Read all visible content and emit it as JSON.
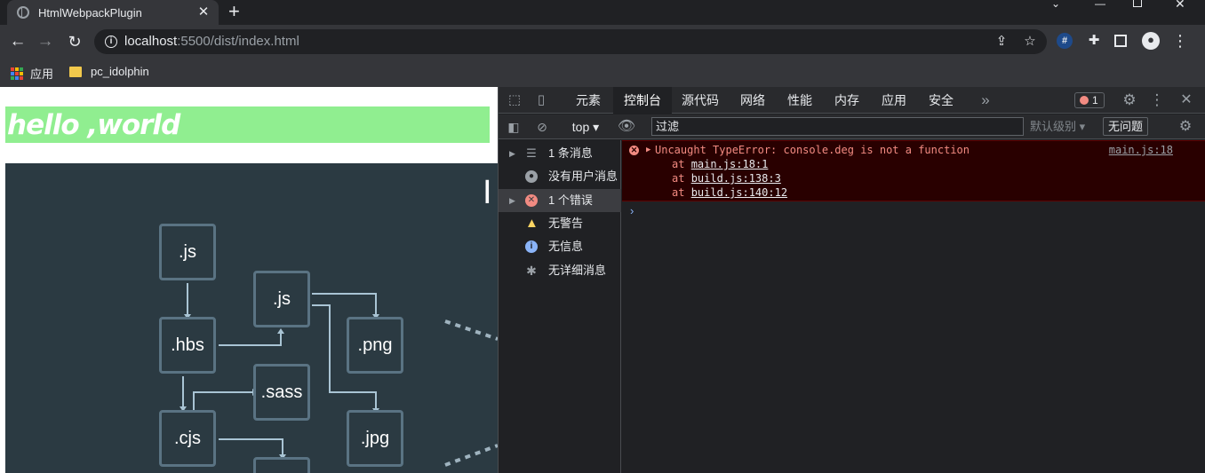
{
  "browser": {
    "tab_title": "HtmlWebpackPlugin",
    "url_host": "localhost",
    "url_rest": ":5500/dist/index.html",
    "bookmarks": [
      {
        "label": "应用"
      },
      {
        "label": "pc_idolphin"
      }
    ]
  },
  "page": {
    "heading": "hello ,world",
    "diagram_nodes": [
      ".js",
      ".js",
      ".png",
      ".hbs",
      ".sass",
      ".cjs",
      ".jpg"
    ],
    "partial_glyph": "I"
  },
  "devtools": {
    "tabs": [
      "元素",
      "控制台",
      "源代码",
      "网络",
      "性能",
      "内存",
      "应用",
      "安全"
    ],
    "active_tab": "控制台",
    "error_count": "1",
    "context": "top",
    "filter_placeholder": "过滤",
    "level": "默认级别",
    "no_issues": "无问题",
    "sidebar": [
      {
        "label": "1 条消息",
        "icon": "list-icon",
        "expandable": true
      },
      {
        "label": "没有用户消息",
        "icon": "user-icon",
        "expandable": false
      },
      {
        "label": "1 个错误",
        "icon": "error-icon",
        "expandable": true
      },
      {
        "label": "无警告",
        "icon": "warning-icon",
        "expandable": false
      },
      {
        "label": "无信息",
        "icon": "info-icon",
        "expandable": false
      },
      {
        "label": "无详细消息",
        "icon": "bug-icon",
        "expandable": false
      }
    ],
    "error": {
      "message": "Uncaught TypeError: console.deg is not a function",
      "source": "main.js:18",
      "stack": [
        {
          "prefix": "at ",
          "link": "main.js:18:1"
        },
        {
          "prefix": "at ",
          "link": "build.js:138:3"
        },
        {
          "prefix": "at ",
          "link": "build.js:140:12"
        }
      ]
    },
    "prompt": "›"
  },
  "colors": {
    "heading_bg": "#90ee90",
    "diagram_bg": "#2b3a42",
    "error_bg": "#290000",
    "error_text": "#f28b82"
  }
}
